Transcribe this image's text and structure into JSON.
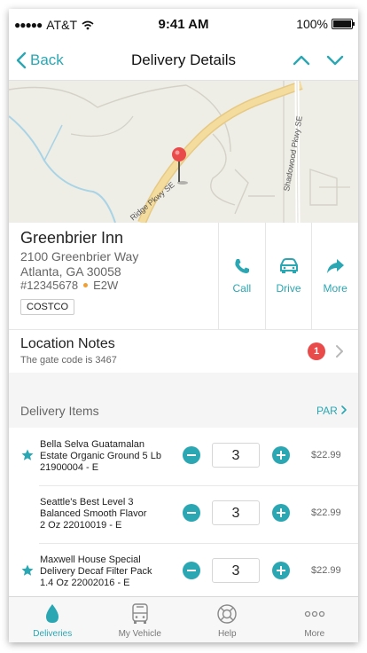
{
  "status_bar": {
    "carrier": "AT&T",
    "time": "9:41 AM",
    "battery": "100%"
  },
  "nav": {
    "back_label": "Back",
    "title": "Delivery Details"
  },
  "map": {
    "road_labels": [
      "Ridge Pkwy SE",
      "Shadowood Pkwy SE"
    ]
  },
  "customer": {
    "name": "Greenbrier Inn",
    "address_line1": "2100 Greenbrier Way",
    "address_line2": "Atlanta, GA 30058",
    "order_number": "#12345678",
    "route_code": "E2W",
    "tag": "COSTCO"
  },
  "actions": [
    {
      "label": "Call",
      "icon": "phone-icon"
    },
    {
      "label": "Drive",
      "icon": "car-icon"
    },
    {
      "label": "More",
      "icon": "share-arrow-icon"
    }
  ],
  "location_notes": {
    "title": "Location Notes",
    "note": "The gate code is 3467",
    "badge_count": "1"
  },
  "delivery_items": {
    "header": "Delivery Items",
    "par_label": "PAR",
    "items": [
      {
        "line1": "Bella Selva Guatamalan",
        "line2": "Estate Organic Ground 5 Lb",
        "line3": "21900004 - E",
        "qty": "3",
        "price": "$22.99",
        "starred": true
      },
      {
        "line1": "Seattle's Best Level 3",
        "line2": "Balanced Smooth Flavor",
        "line3": "2 Oz 22010019 - E",
        "qty": "3",
        "price": "$22.99",
        "starred": false
      },
      {
        "line1": "Maxwell House Special",
        "line2": "Delivery Decaf Filter Pack",
        "line3": "1.4 Oz 22002016 - E",
        "qty": "3",
        "price": "$22.99",
        "starred": true
      }
    ]
  },
  "tabs": [
    {
      "label": "Deliveries",
      "icon": "droplet-icon",
      "active": true
    },
    {
      "label": "My Vehicle",
      "icon": "bus-icon",
      "active": false
    },
    {
      "label": "Help",
      "icon": "lifebuoy-icon",
      "active": false
    },
    {
      "label": "More",
      "icon": "ellipsis-icon",
      "active": false
    }
  ],
  "colors": {
    "accent": "#2aa7b3",
    "badge": "#e94a4a",
    "route_dot": "#f0a030",
    "map_bg": "#eeede6",
    "road": "#f4dc9e"
  }
}
